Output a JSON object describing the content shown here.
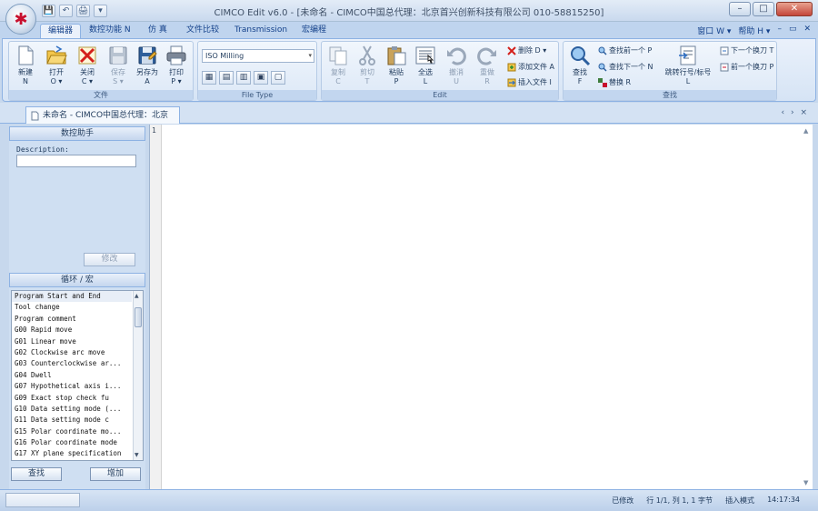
{
  "window": {
    "title": "CIMCO Edit v6.0 - [未命名 - CIMCO中国总代理：北京首兴创新科技有限公司 010-58815250]",
    "orb_glyph": "✱",
    "qat": [
      "💾",
      "↶",
      "🖨",
      "▾"
    ],
    "controls": {
      "minimize": "–",
      "maximize": "□",
      "close": "✕"
    }
  },
  "tabs": [
    "编辑器",
    "数控功能 N",
    "仿 真",
    "文件比较",
    "Transmission",
    "宏编程"
  ],
  "tabbar_right": [
    "窗口 W ▾",
    "帮助 H ▾",
    "–",
    "▭",
    "✕"
  ],
  "ribbon": {
    "file_group": {
      "label": "文件",
      "buttons": [
        {
          "label": "新建",
          "key": "N"
        },
        {
          "label": "打开",
          "key": "O ▾"
        },
        {
          "label": "关闭",
          "key": "C ▾"
        },
        {
          "label": "保存",
          "key": "S ▾"
        },
        {
          "label": "另存为",
          "key": "A"
        },
        {
          "label": "打印",
          "key": "P ▾"
        }
      ]
    },
    "filetype_group": {
      "label": "File Type",
      "combo_value": "ISO Milling",
      "buttons": [
        "▦",
        "▤",
        "▥",
        "▣",
        "▢"
      ]
    },
    "edit_group": {
      "label": "Edit",
      "buttons": [
        {
          "label": "复制",
          "key": "C"
        },
        {
          "label": "剪切",
          "key": "T"
        },
        {
          "label": "粘贴",
          "key": "P"
        },
        {
          "label": "全选",
          "key": "L"
        },
        {
          "label": "撤消",
          "key": "U"
        },
        {
          "label": "重做",
          "key": "R"
        }
      ],
      "small": [
        "删除 D ▾",
        "添加文件 A",
        "插入文件 I"
      ]
    },
    "find_group": {
      "label": "查找",
      "find_button": {
        "label": "查找",
        "key": "F"
      },
      "small": [
        "查找前一个 P",
        "查找下一个 N",
        "替换 R"
      ],
      "goto_button": {
        "label": "跳转行号/标号",
        "key": "L"
      },
      "right_small": [
        "下一个换刀 T",
        "前一个换刀 P"
      ]
    }
  },
  "document": {
    "tab_label": "未命名 - CIMCO中国总代理：北京",
    "nav": "‹ › ×"
  },
  "left_panel": {
    "nc_head": "数控助手",
    "description_label": "Description:",
    "modify_button": "修改",
    "cycle_head": "循环 / 宏",
    "cycle_items": [
      "Program Start and End",
      "Tool change",
      "Program comment",
      "G00 Rapid move",
      "G01 Linear move",
      "G02 Clockwise arc move",
      "G03 Counterclockwise ar...",
      "G04 Dwell",
      "G07 Hypothetical axis i...",
      "G09 Exact stop check fu",
      "G10 Data setting mode (...",
      "G11 Data setting mode c",
      "G15 Polar coordinate mo...",
      "G16 Polar coordinate mode",
      "G17 XY plane specification"
    ],
    "find_button": "查找",
    "add_button": "增加"
  },
  "editor": {
    "line_number": "1"
  },
  "status": {
    "progress": 0.0,
    "mode": "已修改",
    "position": "行 1/1, 列 1, 1 字节",
    "insert": "插入模式",
    "time": "14:17:34"
  }
}
